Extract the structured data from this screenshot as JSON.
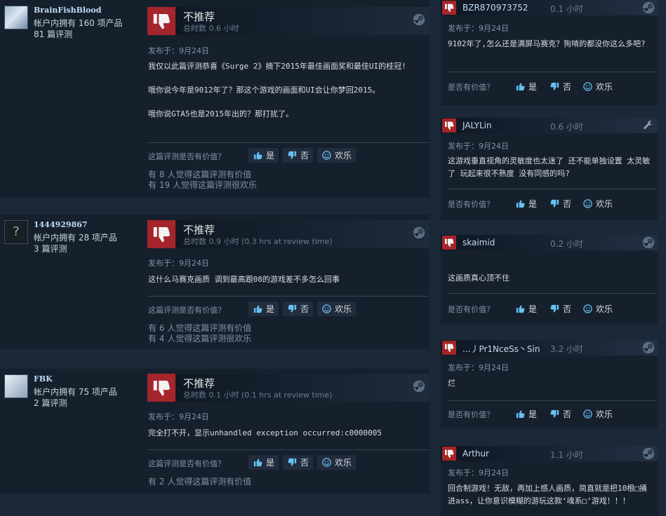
{
  "colors": {
    "background": "#1b2838",
    "card": "#16202d",
    "thumb_down": "#a4252b",
    "accent_blue": "#66c0f4"
  },
  "left_reviews": [
    {
      "avatar_icon": "user-avatar",
      "username": "BrainFishBlood",
      "products": "帐户内拥有 160 项产品",
      "reviews": "81 篇评测",
      "verdict": "不推荐",
      "hours": "总时数 0.6 小时",
      "posted": "发布于：9月24日",
      "body": "我仅以此篇评测恭喜《Surge 2》摘下2015年最佳画面奖和最佳UI的桂冠!\n\n哦你说今年是9012年了？那这个游戏的画面和UI会让你梦回2015。\n\n哦你说GTA5也是2015年出的？那打扰了。",
      "helpful_question": "这篇评测是否有价值？",
      "yes": "是",
      "no": "否",
      "funny": "欢乐",
      "summary_helpful": "有 8 人觉得这篇评测有价值",
      "summary_funny": "有 19 人觉得这篇评测很欢乐"
    },
    {
      "avatar_icon": "question-mark-avatar",
      "avatar_glyph": "?",
      "username": "1444929867",
      "products": "帐户内拥有 28 项产品",
      "reviews": "3 篇评测",
      "verdict": "不推荐",
      "hours": "总时数 0.9 小时 (0.3 hrs at review time)",
      "posted": "发布于：9月24日",
      "body": "这什么马赛克画质 调到最高跟08的游戏差不多怎么回事",
      "helpful_question": "这篇评测是否有价值？",
      "yes": "是",
      "no": "否",
      "funny": "欢乐",
      "summary_helpful": "有 6 人觉得这篇评测有价值",
      "summary_funny": "有 4 人觉得这篇评测很欢乐"
    },
    {
      "avatar_icon": "user-avatar",
      "username": "FBK",
      "products": "帐户内拥有 75 项产品",
      "reviews": "2 篇评测",
      "verdict": "不推荐",
      "hours": "总时数 0.1 小时 (0.1 hrs at review time)",
      "posted": "发布于：9月24日",
      "body": "完全打不开，显示unhandled exception occurred:c0000005",
      "helpful_question": "这篇评测是否有价值？",
      "yes": "是",
      "no": "否",
      "funny": "欢乐",
      "summary_helpful": "有 2 人觉得这篇评测有价值",
      "summary_funny": ""
    }
  ],
  "right_reviews": [
    {
      "username": "BZR870973752",
      "hours": "0.1 小时",
      "icon": "steam-icon",
      "posted": "发布于：9月24日",
      "body": "9102年了,怎么还是满屏马赛克？狗啃的都没你这么多吧?",
      "helpful_question": "是否有价值？",
      "yes": "是",
      "no": "否",
      "funny": "欢乐"
    },
    {
      "username": "JALYLin",
      "hours": "0.6 小时",
      "icon": "wrench-icon",
      "posted": "发布于：9月24日",
      "body": "这游戏垂直视角的灵敏度也太迷了 还不能单独设置 太灵敏了 玩起来很不熟度 没有同感的吗?",
      "helpful_question": "是否有价值？",
      "yes": "是",
      "no": "否",
      "funny": "欢乐"
    },
    {
      "username": "skaimid",
      "hours": "0.2 小时",
      "icon": "steam-icon",
      "posted": "",
      "body": "这画质真心顶不住",
      "helpful_question": "是否有价值？",
      "yes": "是",
      "no": "否",
      "funny": "欢乐"
    },
    {
      "username": "...丿Pr1NceSs丶Sin",
      "hours": "3.2 小时",
      "icon": "steam-icon",
      "posted": "发布于：9月24日",
      "body": "烂",
      "helpful_question": "是否有价值？",
      "yes": "是",
      "no": "否",
      "funny": "欢乐"
    },
    {
      "username": "Arthur",
      "hours": "1.1 小时",
      "icon": "steam-icon",
      "posted": "发布于：9月24日",
      "body": "回合制游戏！无敌，再加上感人画质，简直就是把10根□捅进ass，让你意识模糊的游玩这款‘魂系□’游戏！！！"
    }
  ]
}
